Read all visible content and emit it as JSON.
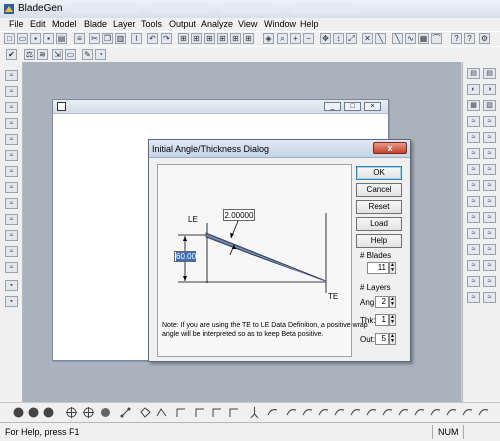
{
  "app": {
    "title": "BladeGen"
  },
  "menu": [
    "File",
    "Edit",
    "Model",
    "Blade",
    "Layer",
    "Tools",
    "Output",
    "Analyze",
    "View",
    "Window",
    "Help"
  ],
  "toolbar_icons": [
    "new-icon",
    "open-icon",
    "save-icon",
    "print-icon",
    "cut-icon",
    "copy-icon",
    "paste-icon",
    "undo-icon",
    "redo-icon",
    "grid-icon",
    "view-icon",
    "zoom-in-icon",
    "zoom-out-icon",
    "help-icon"
  ],
  "dialog": {
    "title": "Initial Angle/Thickness Dialog",
    "close_label": "x",
    "buttons": {
      "ok": "OK",
      "cancel": "Cancel",
      "reset": "Reset",
      "load": "Load",
      "help": "Help"
    },
    "blades": {
      "label": "# Blades",
      "value": "11"
    },
    "layers": {
      "label": "# Layers",
      "ang_label": "Ang:",
      "ang_value": "2",
      "thk_label": "Thk:",
      "thk_value": "1",
      "out_label": "Out:",
      "out_value": "5"
    },
    "diagram": {
      "le_label": "LE",
      "te_label": "TE",
      "thickness_value": "2.00000",
      "angle_value": "60.00"
    },
    "note": "Note: If you are using the TE to LE Data Definition, a positive wrap angle will be interpreted so as to keep Beta positive."
  },
  "status": {
    "message": "For Help, press F1",
    "num": "NUM"
  }
}
